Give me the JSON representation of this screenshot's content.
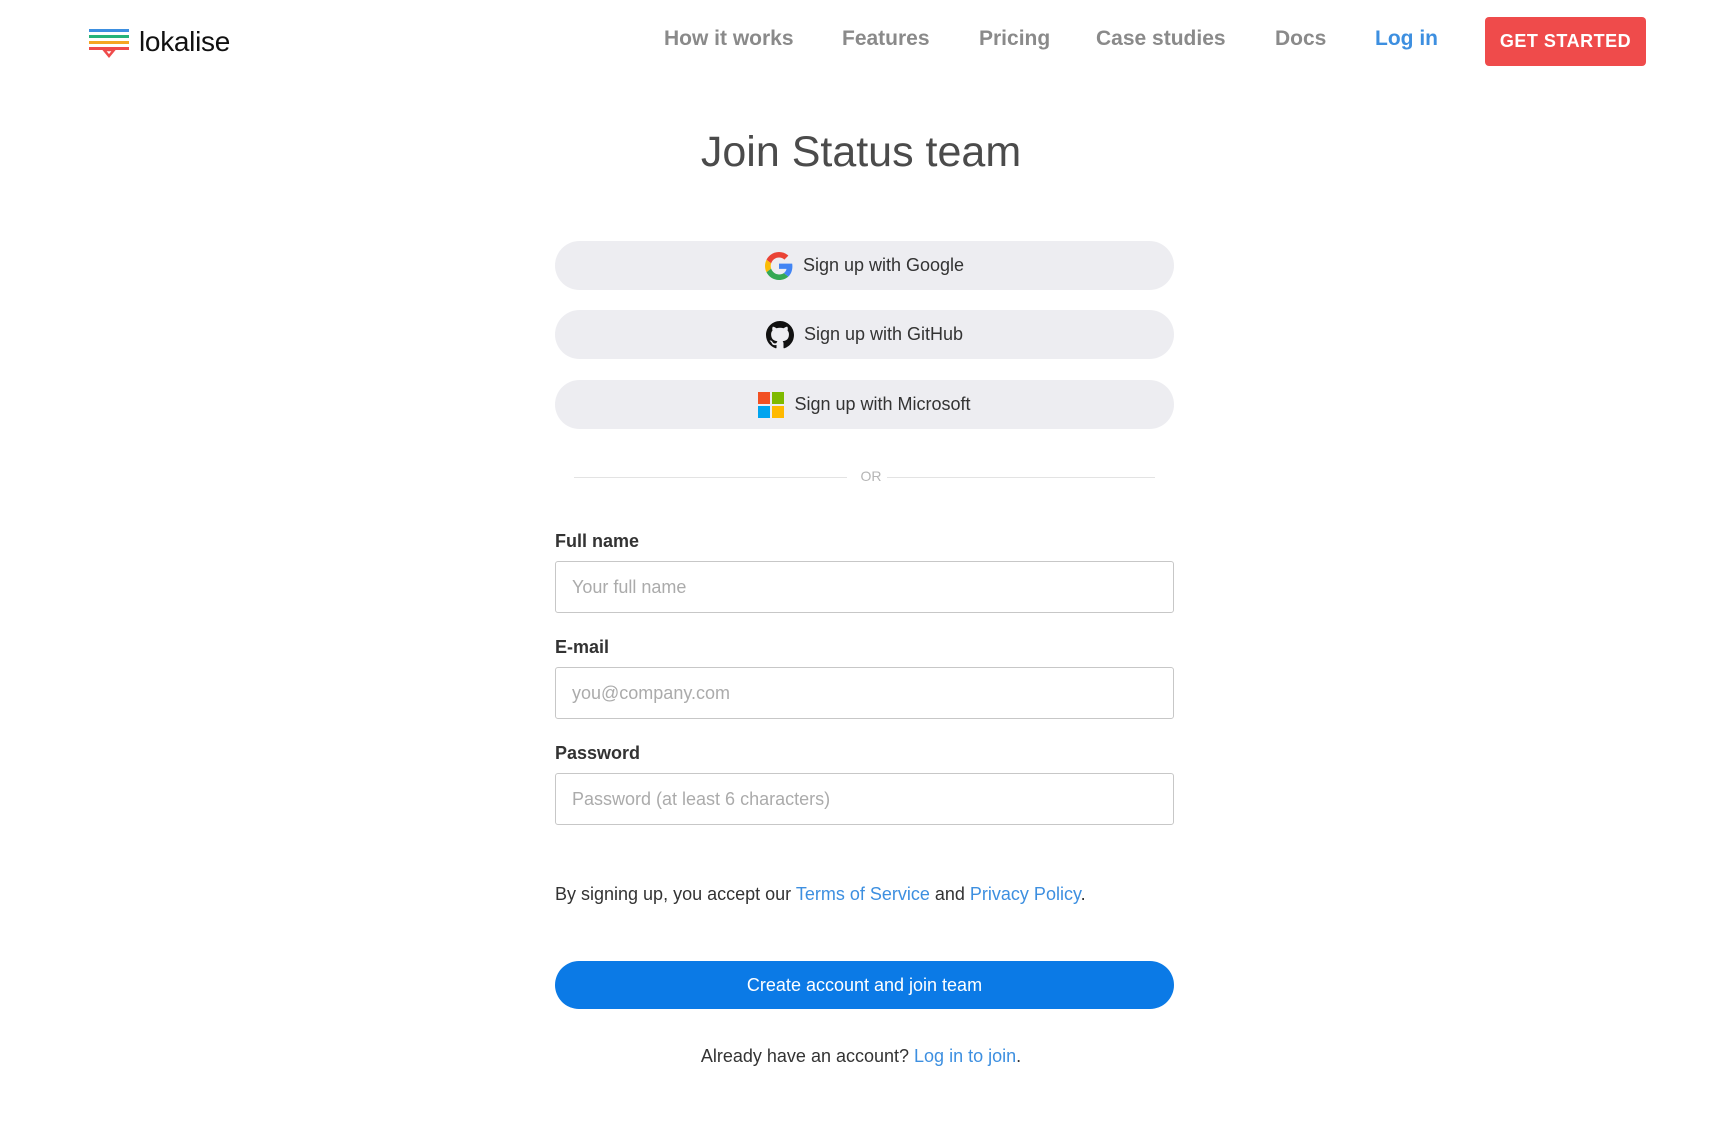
{
  "header": {
    "brand": "lokalise",
    "nav": [
      {
        "label": "How it works"
      },
      {
        "label": "Features"
      },
      {
        "label": "Pricing"
      },
      {
        "label": "Case studies"
      },
      {
        "label": "Docs"
      },
      {
        "label": "Log in",
        "active": true
      }
    ],
    "cta_label": "GET STARTED"
  },
  "page": {
    "title": "Join Status team"
  },
  "social": {
    "google_label": "Sign up with Google",
    "github_label": "Sign up with GitHub",
    "microsoft_label": "Sign up with Microsoft"
  },
  "divider_text": "OR",
  "form": {
    "full_name": {
      "label": "Full name",
      "placeholder": "Your full name",
      "value": ""
    },
    "email": {
      "label": "E-mail",
      "placeholder": "you@company.com",
      "value": ""
    },
    "password": {
      "label": "Password",
      "placeholder": "Password (at least 6 characters)",
      "value": ""
    }
  },
  "terms": {
    "prefix": "By signing up, you accept our ",
    "tos_label": "Terms of Service",
    "middle": " and ",
    "privacy_label": "Privacy Policy",
    "suffix": "."
  },
  "submit_label": "Create account and join team",
  "footer": {
    "prefix": "Already have an account? ",
    "link_label": "Log in to join",
    "suffix": "."
  },
  "colors": {
    "accent": "#3d8fe0",
    "cta": "#ef4b4b",
    "primary_button": "#0b7ae6",
    "social_button_bg": "#ededf1"
  },
  "icons": {
    "logo": "lokalise-logo-icon",
    "google": "google-icon",
    "github": "github-icon",
    "microsoft": "microsoft-icon"
  }
}
